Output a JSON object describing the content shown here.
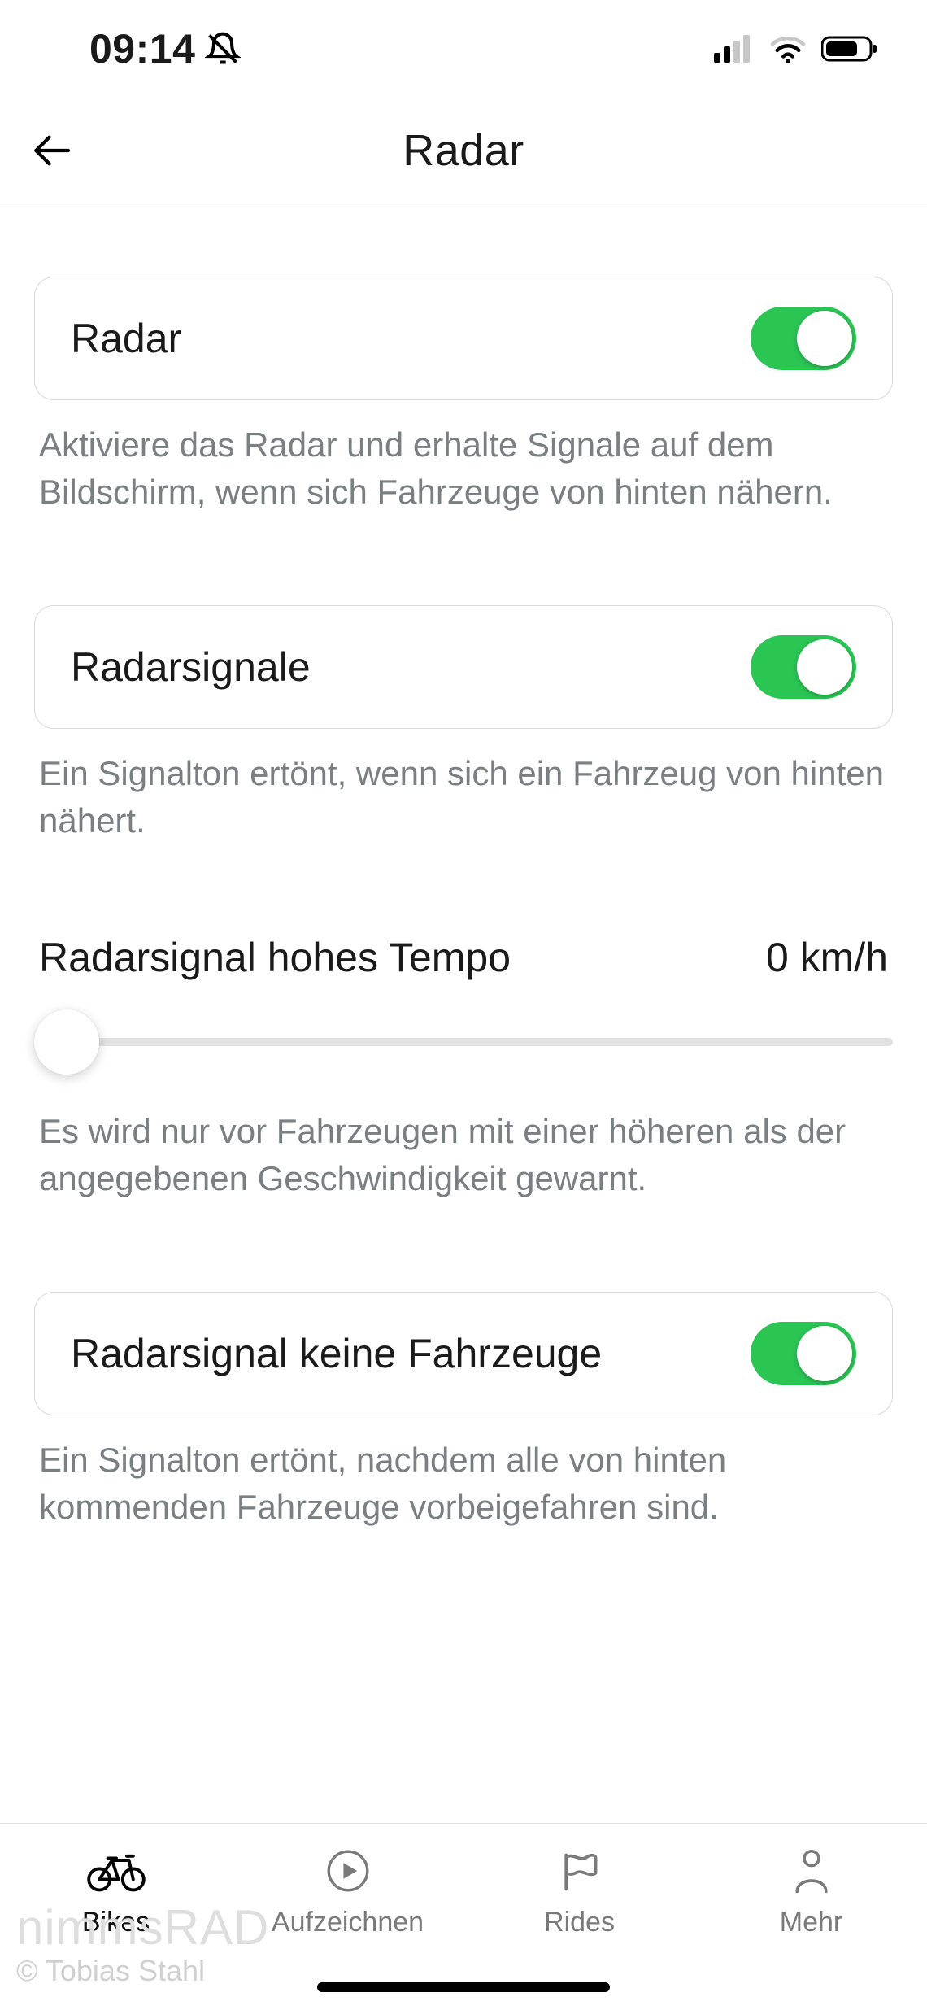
{
  "status": {
    "time": "09:14",
    "silent_icon": "bell-slash-icon",
    "signal_icon": "cellular-signal-icon",
    "wifi_icon": "wifi-icon",
    "battery_icon": "battery-icon"
  },
  "header": {
    "title": "Radar",
    "back_icon": "arrow-left-icon"
  },
  "settings": {
    "radar": {
      "label": "Radar",
      "enabled": true,
      "desc": "Aktiviere das Radar und erhalte Signale auf dem Bildschirm, wenn sich Fahrzeuge von hinten nähern."
    },
    "radarsignale": {
      "label": "Radarsignale",
      "enabled": true,
      "desc": "Ein Signalton ertönt, wenn sich ein Fahrzeug von hinten nähert."
    },
    "high_speed": {
      "label": "Radarsignal hohes Tempo",
      "value": "0 km/h",
      "desc": "Es wird nur vor Fahrzeugen mit einer höheren als der angegebenen Geschwindigkeit gewarnt."
    },
    "no_vehicles": {
      "label": "Radarsignal keine Fahrzeuge",
      "enabled": true,
      "desc": "Ein Signalton ertönt, nachdem alle von hinten kommenden Fahrzeuge vorbeigefahren sind."
    }
  },
  "tabs": {
    "bikes": {
      "label": "Bikes",
      "icon": "bike-icon"
    },
    "record": {
      "label": "Aufzeichnen",
      "icon": "record-icon"
    },
    "rides": {
      "label": "Rides",
      "icon": "flag-icon"
    },
    "more": {
      "label": "Mehr",
      "icon": "person-icon"
    }
  },
  "watermark": {
    "line1": "nimmsRAD",
    "line2": "© Tobias Stahl"
  }
}
